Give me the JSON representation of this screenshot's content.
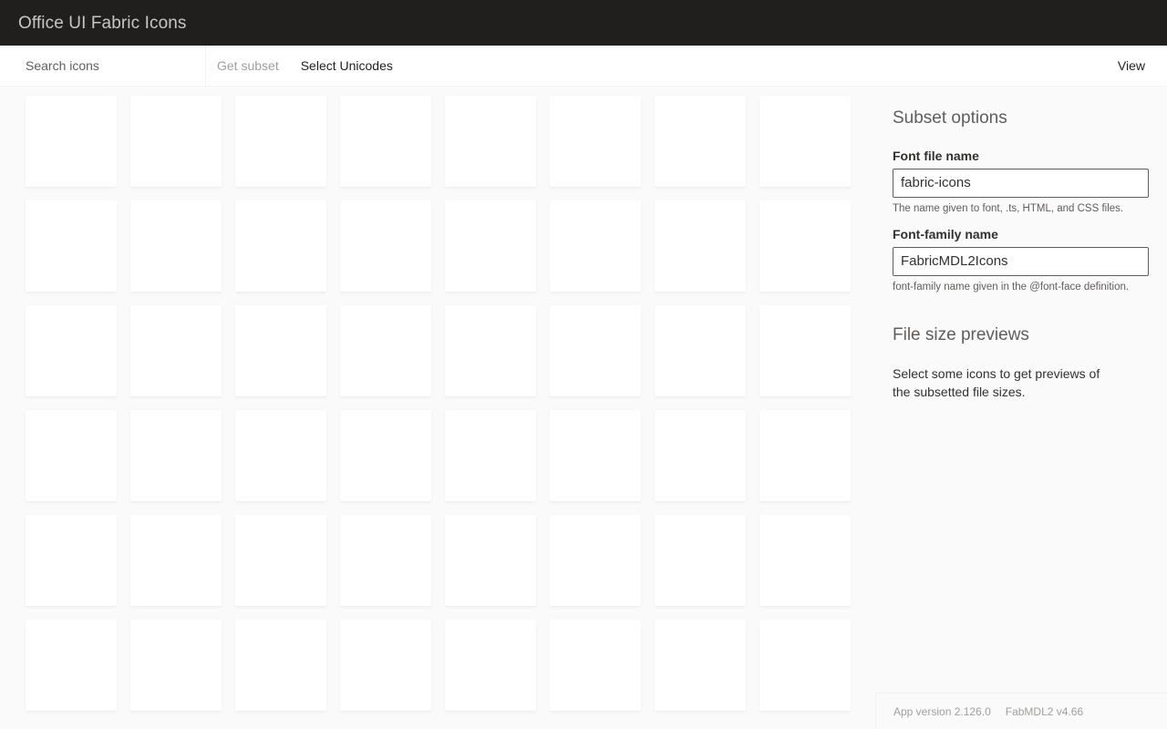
{
  "titlebar": {
    "title": "Office UI Fabric Icons"
  },
  "commandbar": {
    "search": {
      "placeholder": "Search icons",
      "value": ""
    },
    "items": [
      {
        "label": "Get subset",
        "disabled": true,
        "name": "get-subset"
      },
      {
        "label": "Select Unicodes",
        "disabled": false,
        "name": "select-unicodes"
      }
    ],
    "far_items": [
      {
        "label": "View",
        "disabled": false,
        "name": "view"
      }
    ]
  },
  "grid": {
    "columns": 8,
    "rows": 6,
    "tile_count": 48
  },
  "panel": {
    "subset_options": {
      "heading": "Subset options",
      "font_file_name": {
        "label": "Font file name",
        "value": "fabric-icons",
        "placeholder": "fabric-icons",
        "hint": "The name given to font, .ts, HTML, and CSS files."
      },
      "font_family_name": {
        "label": "Font-family name",
        "value": "FabricMDL2Icons",
        "placeholder": "FabricMDL2Icons",
        "hint": "font-family name given in the @font-face definition."
      }
    },
    "file_size_previews": {
      "heading": "File size previews",
      "message": "Select some icons to get previews of the subsetted file sizes."
    }
  },
  "footer": {
    "app_version": "App version 2.126.0",
    "font_version": "FabMDL2 v4.66"
  },
  "colors": {
    "titlebar_bg": "#201f1e",
    "titlebar_text": "#c8c6c4",
    "page_bg": "#fafafa",
    "tile_bg": "#ffffff",
    "accent": "#0078d4",
    "text_primary": "#323130",
    "text_secondary": "#605e5c",
    "text_disabled": "#a19f9d"
  }
}
